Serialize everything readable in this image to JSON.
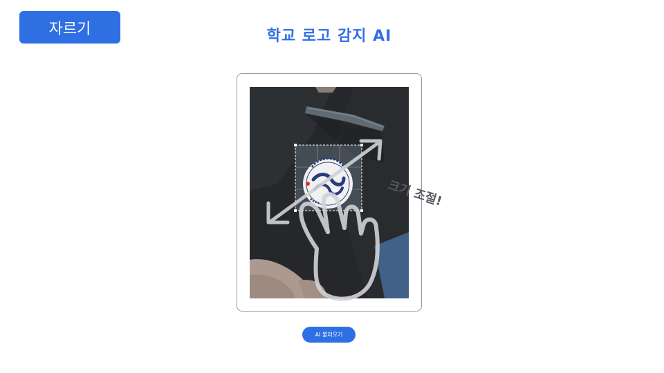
{
  "toolbar": {
    "crop_label": "자르기"
  },
  "header": {
    "title": "학교 로고 감지 AI"
  },
  "canvas": {
    "hint_text": "크기 조절!",
    "hint_icon": "hand-pointer-icon",
    "resize_icon": "resize-arrows-icon"
  },
  "actions": {
    "load_ai_label": "AI 불러오기"
  },
  "colors": {
    "accent": "#2f6fe4",
    "background": "#ffffff"
  }
}
